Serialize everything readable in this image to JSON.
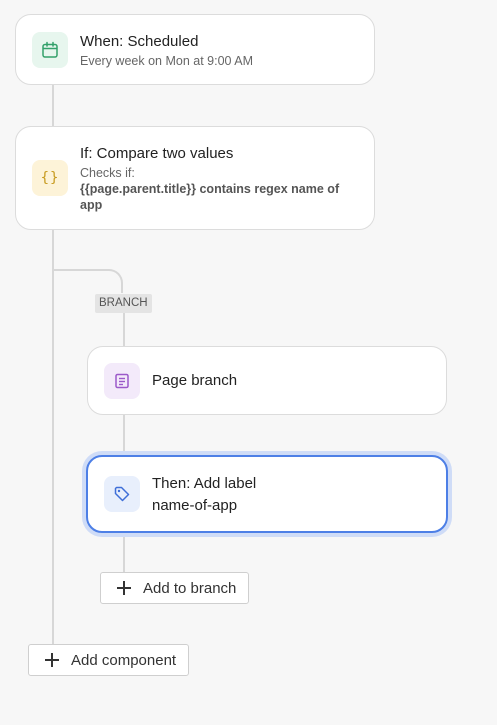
{
  "trigger": {
    "title": "When: Scheduled",
    "subtitle": "Every week on Mon at 9:00 AM",
    "icon": "calendar-icon",
    "accent": "#33a06a",
    "tile_bg": "#e7f6ee"
  },
  "condition": {
    "title": "If: Compare two values",
    "checks_label": "Checks if:",
    "expression_line1": "{{page.parent.title}} contains regex name of",
    "expression_line2": "app",
    "icon": "braces-icon",
    "accent": "#c79a1e",
    "tile_bg": "#fdf3d8"
  },
  "branch_tag": "BRANCH",
  "page_branch": {
    "title": "Page branch",
    "icon": "page-icon",
    "accent": "#9b59c9",
    "tile_bg": "#f3eafa"
  },
  "action": {
    "title": "Then: Add label",
    "label": "name-of-app",
    "icon": "tag-icon",
    "accent": "#3f6fd8",
    "tile_bg": "#e8effc",
    "selected": true
  },
  "add_to_branch": "Add to branch",
  "add_component": "Add component"
}
